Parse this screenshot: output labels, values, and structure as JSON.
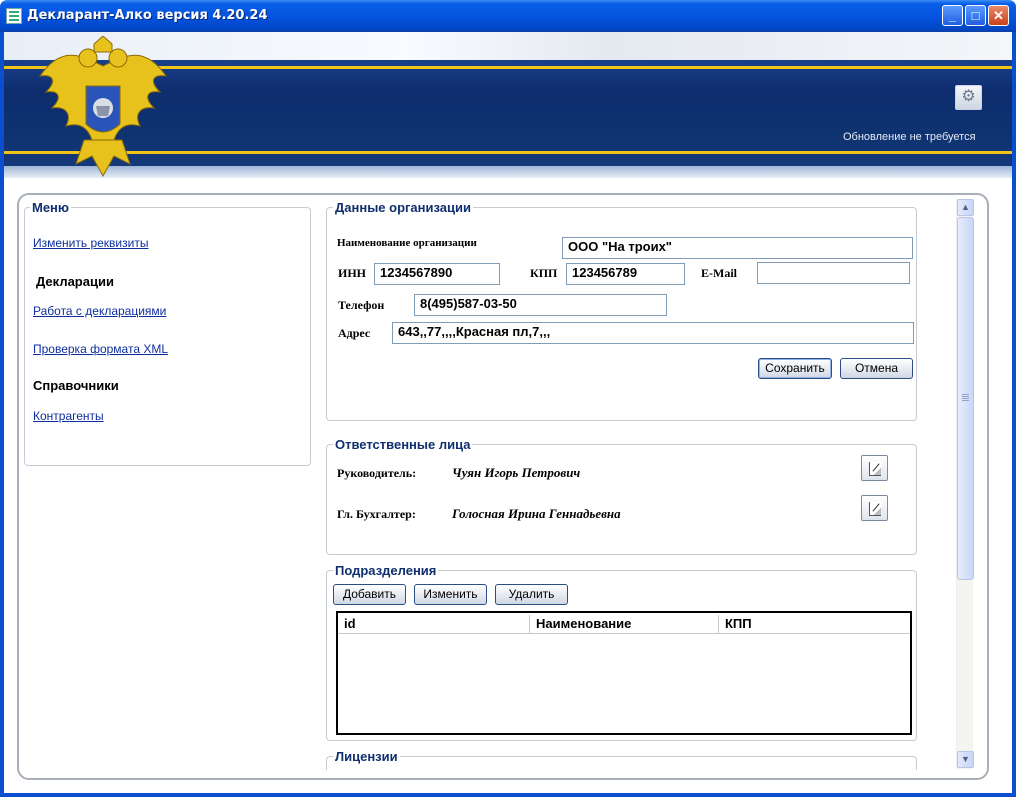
{
  "window": {
    "title": "Декларант-Алко версия 4.20.24",
    "controls": {
      "minimize": "_",
      "maximize": "□",
      "close": "✕"
    }
  },
  "header": {
    "update_status": "Обновление не требуется",
    "settings_icon": "gear-icon",
    "emblem": "russian-coat-of-arms",
    "colors": {
      "banner": "#0f3270",
      "stripe": "#f0c418"
    }
  },
  "menu": {
    "title": "Меню",
    "edit_requisites": "Изменить реквизиты",
    "declarations_heading": "Декларации",
    "work_with_declarations": "Работа с декларациями",
    "check_xml": "Проверка формата XML",
    "directories_heading": "Справочники",
    "contractors": "Контрагенты"
  },
  "org": {
    "title": "Данные организации",
    "name_label": "Наименование организации",
    "name_value": "ООО \"На троих\"",
    "inn_label": "ИНН",
    "inn_value": "1234567890",
    "kpp_label": "КПП",
    "kpp_value": "123456789",
    "email_label": "E-Mail",
    "email_value": "",
    "phone_label": "Телефон",
    "phone_value": "8(495)587-03-50",
    "address_label": "Адрес",
    "address_value": "643,,77,,,,Красная пл,7,,,",
    "save_button": "Сохранить",
    "cancel_button": "Отмена"
  },
  "responsible": {
    "title": "Ответственные лица",
    "head_label": "Руководитель:",
    "head_name": "Чуян Игорь Петрович",
    "accountant_label": "Гл. Бухгалтер:",
    "accountant_name": "Голосная Ирина Геннадьевна"
  },
  "subdivisions": {
    "title": "Подразделения",
    "add_button": "Добавить",
    "edit_button": "Изменить",
    "delete_button": "Удалить",
    "columns": [
      "id",
      "Наименование",
      "КПП"
    ],
    "rows": []
  },
  "licenses": {
    "title": "Лицензии"
  }
}
